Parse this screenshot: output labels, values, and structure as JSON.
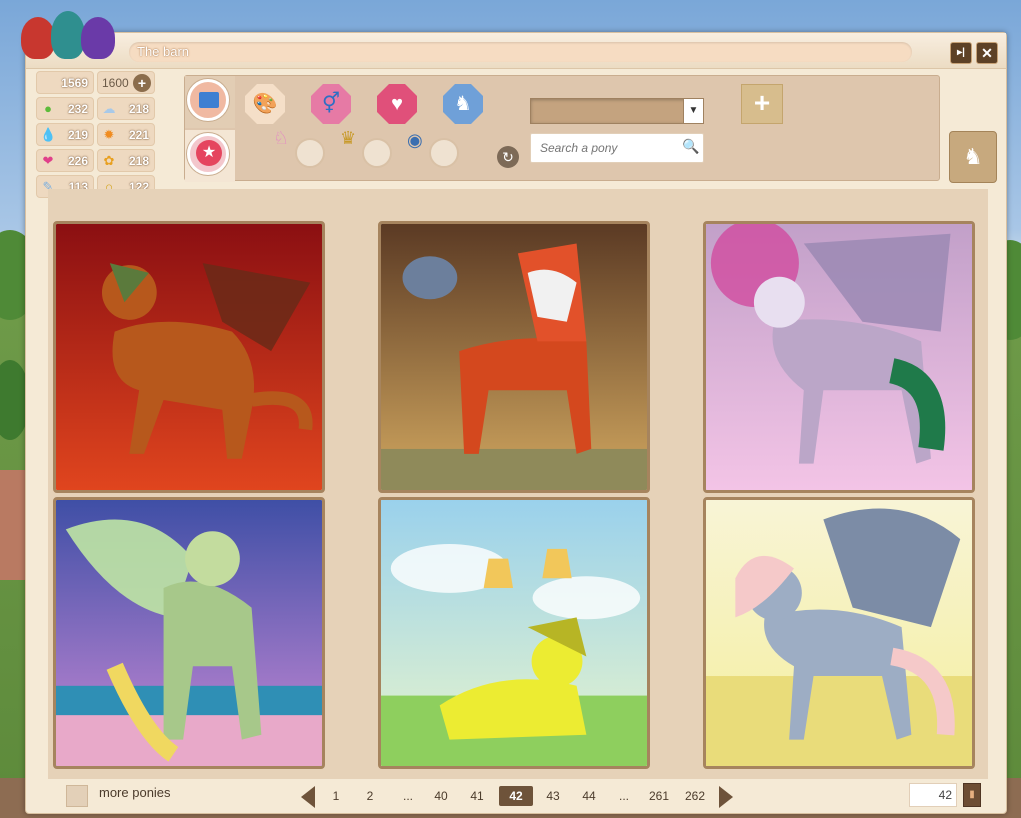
{
  "window": {
    "title": "The barn"
  },
  "titlebar": {
    "minimize_label": "▸|",
    "close_label": "✕"
  },
  "stats": [
    {
      "name": "money",
      "value": "1569",
      "icon": "coin-icon",
      "color": "#eed9c0"
    },
    {
      "name": "money-max",
      "value": "1600",
      "icon": "plus-icon"
    },
    {
      "name": "health",
      "value": "232",
      "icon": "apple-icon",
      "color": "#5dbb3a"
    },
    {
      "name": "weather",
      "value": "218",
      "icon": "cloud-icon",
      "color": "#a8c9e8"
    },
    {
      "name": "hygiene",
      "value": "219",
      "icon": "drops-icon",
      "color": "#3aa2d8"
    },
    {
      "name": "energy",
      "value": "221",
      "icon": "flame-icon",
      "color": "#f08c20"
    },
    {
      "name": "mood",
      "value": "226",
      "icon": "heart-icon",
      "color": "#e0408a"
    },
    {
      "name": "affection",
      "value": "218",
      "icon": "paw-icon",
      "color": "#e8a020"
    },
    {
      "name": "care",
      "value": "113",
      "icon": "brush-icon",
      "color": "#a8c9e8"
    },
    {
      "name": "stamina",
      "value": "122",
      "icon": "horseshoe-icon",
      "color": "#d4a82a"
    }
  ],
  "filters": {
    "select_value": "",
    "search_placeholder": "Search a pony",
    "add_label": "+",
    "icons": [
      "paint-palette-icon",
      "gender-icon",
      "breeding-icon",
      "pair-icon",
      "unicorn-icon",
      "trophy-icon",
      "eye-icon"
    ]
  },
  "ponies": [
    {
      "name": "pony-1",
      "bg1": "#8b0f12",
      "bg2": "#e0451e",
      "body": "#b7581c"
    },
    {
      "name": "pony-2",
      "bg1": "#5b3a24",
      "bg2": "#d2a860",
      "body": "#d4481e"
    },
    {
      "name": "pony-3",
      "bg1": "#c2a0c9",
      "bg2": "#f3c4e6",
      "body": "#bba6c8"
    },
    {
      "name": "pony-4",
      "bg1": "#3f4fa6",
      "bg2": "#c98ad6",
      "body": "#a7c88a"
    },
    {
      "name": "pony-5",
      "bg1": "#9ad1ec",
      "bg2": "#e8f5cc",
      "body": "#ecec32"
    },
    {
      "name": "pony-6",
      "bg1": "#f8f4d6",
      "bg2": "#f4ef9d",
      "body": "#9dadc4"
    }
  ],
  "footer": {
    "more_ponies": "more ponies",
    "pages": [
      "1",
      "2",
      "...",
      "40",
      "41",
      "42",
      "43",
      "44",
      "...",
      "261",
      "262"
    ],
    "current_page": "42",
    "page_input": "42",
    "go_label": "▮"
  }
}
